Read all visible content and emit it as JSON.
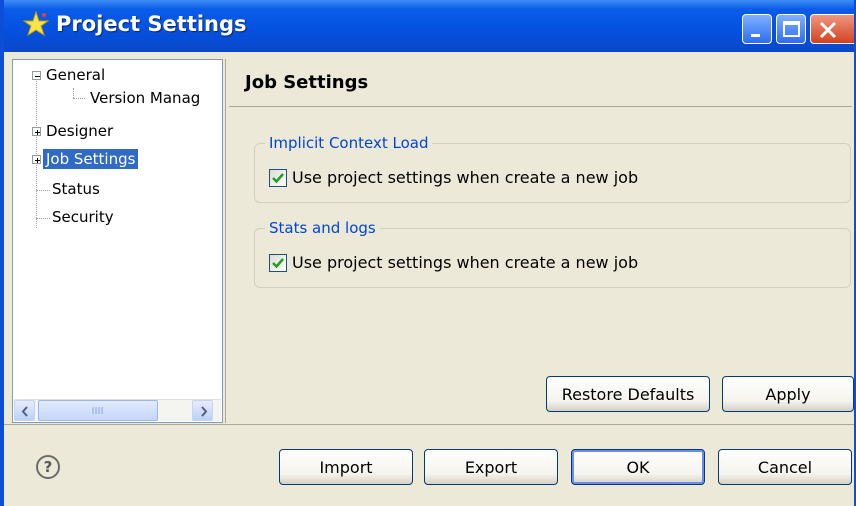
{
  "window": {
    "title": "Project Settings",
    "icon": "star-icon",
    "controls": [
      "minimize-icon",
      "maximize-icon",
      "close-icon"
    ]
  },
  "tree": {
    "items": [
      {
        "label": "General",
        "expander": "minus"
      },
      {
        "label": "Version Manag"
      },
      {
        "label": "Designer",
        "expander": "plus"
      },
      {
        "label": "Job Settings",
        "expander": "plus",
        "selected": true
      },
      {
        "label": "Status"
      },
      {
        "label": "Security"
      }
    ]
  },
  "page": {
    "title": "Job Settings",
    "groups": [
      {
        "legend": "Implicit Context Load",
        "checkbox_label": "Use project settings when create a new job",
        "checked": true
      },
      {
        "legend": "Stats and logs",
        "checkbox_label": "Use project settings when create a new job",
        "checked": true
      }
    ],
    "restore_defaults_label": "Restore Defaults",
    "apply_label": "Apply"
  },
  "footer": {
    "help": "?",
    "import_label": "Import",
    "export_label": "Export",
    "ok_label": "OK",
    "cancel_label": "Cancel"
  },
  "colors": {
    "titlebar": "#0550df",
    "selection": "#316ac5",
    "group_legend": "#0046d5",
    "dialog_bg": "#ece9d8"
  }
}
